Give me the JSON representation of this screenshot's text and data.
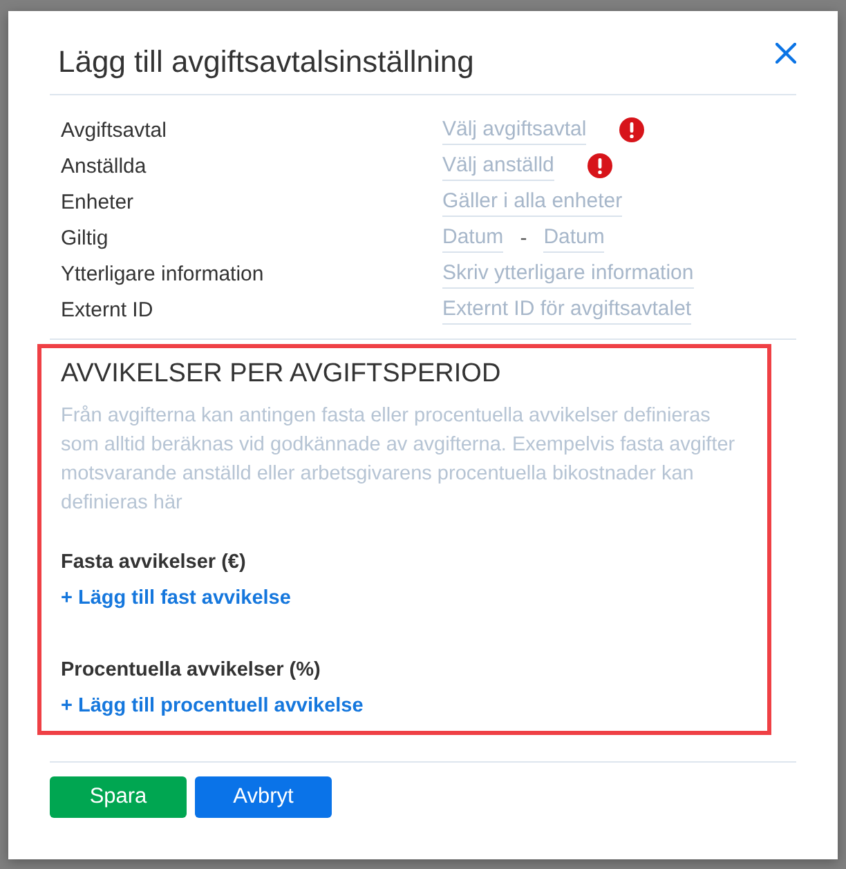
{
  "dialog": {
    "title": "Lägg till avgiftsavtalsinställning",
    "fields": [
      {
        "label": "Avgiftsavtal",
        "kind": "select",
        "placeholder": "Välj avgiftsavtal",
        "error": true
      },
      {
        "label": "Anställda",
        "kind": "select",
        "placeholder": "Välj anställd",
        "error": true
      },
      {
        "label": "Enheter",
        "kind": "select",
        "placeholder": "Gäller i alla enheter",
        "error": false
      },
      {
        "label": "Giltig",
        "kind": "range",
        "from": {
          "placeholder": "Datum"
        },
        "separator": "-",
        "to": {
          "placeholder": "Datum"
        },
        "error": false
      },
      {
        "label": "Ytterligare information",
        "kind": "text",
        "placeholder": "Skriv ytterligare information",
        "error": false
      },
      {
        "label": "Externt ID",
        "kind": "text",
        "placeholder": "Externt ID för avgiftsavtalet",
        "error": false
      }
    ],
    "deviations": {
      "highlighted": true,
      "title": "AVVIKELSER PER AVGIFTSPERIOD",
      "description": "Från avgifterna kan antingen fasta eller procentuella avvikelser definieras som alltid beräknas vid godkännade av avgifterna. Exempelvis fasta avgifter motsvarande anställd eller arbetsgivarens procentuella bikostnader kan definieras här",
      "groups": [
        {
          "title": "Fasta avvikelser (€)",
          "add_link": "+ Lägg till fast avvikelse"
        },
        {
          "title": "Procentuella avvikelser (%)",
          "add_link": "+ Lägg till procentuell avvikelse"
        }
      ]
    },
    "buttons": [
      {
        "label": "Spara",
        "kind": "success"
      },
      {
        "label": "Avbryt",
        "kind": "primary"
      }
    ]
  }
}
